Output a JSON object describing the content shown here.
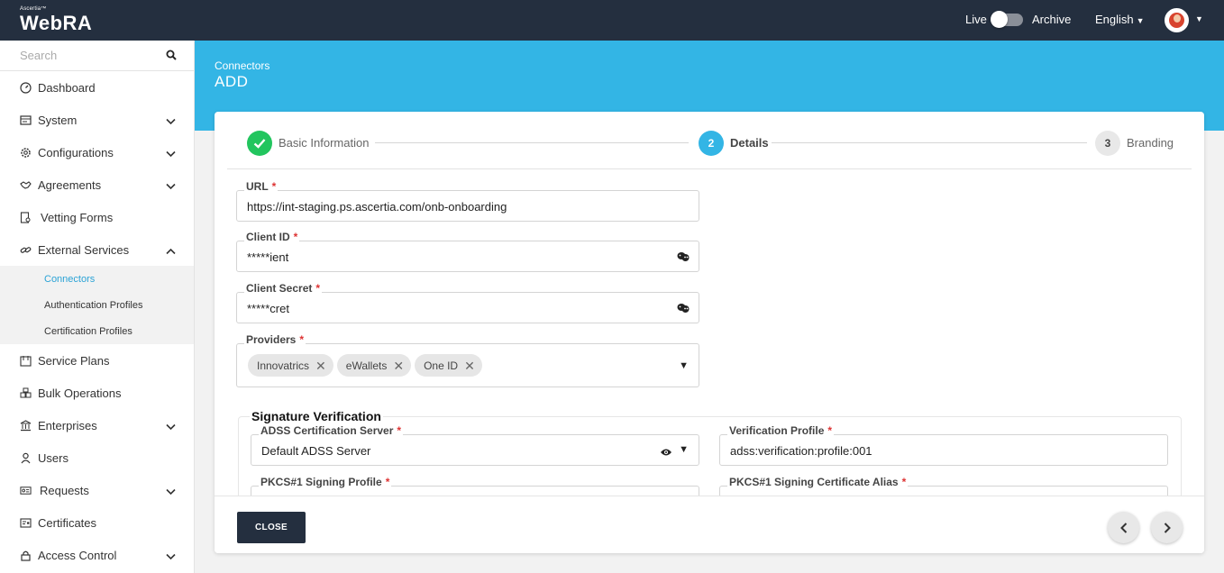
{
  "header": {
    "brand_small": "Ascertia™",
    "brand": "WebRA",
    "live_label": "Live",
    "archive_label": "Archive",
    "language": "English"
  },
  "sidebar": {
    "search_placeholder": "Search",
    "items": [
      {
        "label": "Dashboard"
      },
      {
        "label": "System"
      },
      {
        "label": "Configurations"
      },
      {
        "label": "Agreements"
      },
      {
        "label": "Vetting Forms"
      },
      {
        "label": "External Services"
      },
      {
        "label": "Service Plans"
      },
      {
        "label": "Bulk Operations"
      },
      {
        "label": "Enterprises"
      },
      {
        "label": "Users"
      },
      {
        "label": "Requests"
      },
      {
        "label": "Certificates"
      },
      {
        "label": "Access Control"
      }
    ],
    "sub_items": [
      {
        "label": "Connectors"
      },
      {
        "label": "Authentication Profiles"
      },
      {
        "label": "Certification Profiles"
      }
    ]
  },
  "page": {
    "breadcrumb": "Connectors",
    "title": "ADD"
  },
  "stepper": {
    "steps": [
      {
        "number": "",
        "label": "Basic Information",
        "state": "done"
      },
      {
        "number": "2",
        "label": "Details",
        "state": "active"
      },
      {
        "number": "3",
        "label": "Branding",
        "state": "pending"
      }
    ]
  },
  "form": {
    "url": {
      "label": "URL",
      "value": "https://int-staging.ps.ascertia.com/onb-onboarding"
    },
    "client_id": {
      "label": "Client ID",
      "value": "*****ient"
    },
    "client_secret": {
      "label": "Client Secret",
      "value": "*****cret"
    },
    "providers": {
      "label": "Providers",
      "chips": [
        "Innovatrics",
        "eWallets",
        "One ID"
      ]
    },
    "signature_section": "Signature Verification",
    "adss_server": {
      "label": "ADSS Certification Server",
      "value": "Default ADSS Server"
    },
    "verification_profile": {
      "label": "Verification Profile",
      "value": "adss:verification:profile:001"
    },
    "pkcs_profile": {
      "label": "PKCS#1 Signing Profile"
    },
    "pkcs_alias": {
      "label": "PKCS#1 Signing Certificate Alias"
    }
  },
  "footer": {
    "close_label": "CLOSE"
  },
  "colors": {
    "topbar": "#242f3f",
    "banner": "#33b5e5",
    "step_done": "#22c55e",
    "step_active": "#33b5e5",
    "link_active": "#2ba3d6"
  }
}
